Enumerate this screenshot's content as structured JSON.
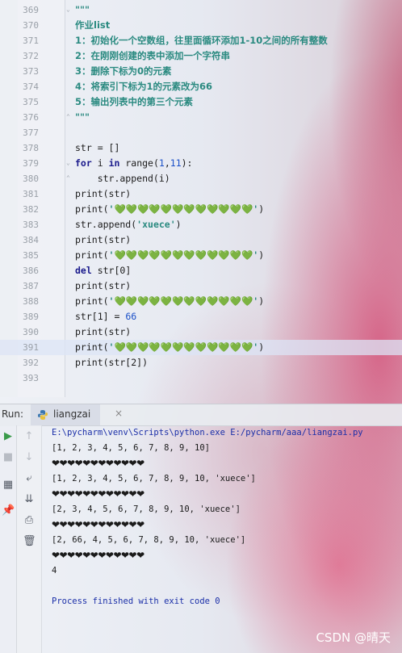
{
  "editor": {
    "lines": [
      {
        "n": "369",
        "text": "\"\"\""
      },
      {
        "n": "370",
        "text": "作业list"
      },
      {
        "n": "371",
        "text": "1：初始化一个空数组，往里面循环添加1-10之间的所有整数"
      },
      {
        "n": "372",
        "text": "2：在刚刚创建的表中添加一个字符串"
      },
      {
        "n": "373",
        "text": "3：删除下标为0的元素"
      },
      {
        "n": "374",
        "text": "4：将索引下标为1的元素改为66"
      },
      {
        "n": "375",
        "text": "5：输出列表中的第三个元素"
      },
      {
        "n": "376",
        "text": "\"\"\""
      },
      {
        "n": "377",
        "text": ""
      },
      {
        "n": "378",
        "text": "str = []"
      },
      {
        "n": "379",
        "text": "for i in range(1,11):"
      },
      {
        "n": "380",
        "text": "    str.append(i)"
      },
      {
        "n": "381",
        "text": "print(str)"
      },
      {
        "n": "382",
        "text": "print('💚💚💚💚💚💚💚💚💚💚💚💚')"
      },
      {
        "n": "383",
        "text": "str.append('xuece')"
      },
      {
        "n": "384",
        "text": "print(str)"
      },
      {
        "n": "385",
        "text": "print('💚💚💚💚💚💚💚💚💚💚💚💚')"
      },
      {
        "n": "386",
        "text": "del str[0]"
      },
      {
        "n": "387",
        "text": "print(str)"
      },
      {
        "n": "388",
        "text": "print('💚💚💚💚💚💚💚💚💚💚💚💚')"
      },
      {
        "n": "389",
        "text": "str[1] = 66"
      },
      {
        "n": "390",
        "text": "print(str)"
      },
      {
        "n": "391",
        "text": "print('💚💚💚💚💚💚💚💚💚💚💚💚')"
      },
      {
        "n": "392",
        "text": "print(str[2])"
      },
      {
        "n": "393",
        "text": ""
      }
    ],
    "current_line": "391"
  },
  "run_panel": {
    "label": "Run:",
    "tab_label": "liangzai",
    "close_glyph": "×",
    "console": {
      "command": "E:\\pycharm\\venv\\Scripts\\python.exe E:/pycharm/aaa/liangzai.py",
      "out1": "[1, 2, 3, 4, 5, 6, 7, 8, 9, 10]",
      "hearts1": "❤❤❤❤❤❤❤❤❤❤❤❤",
      "out2": "[1, 2, 3, 4, 5, 6, 7, 8, 9, 10, 'xuece']",
      "hearts2": "❤❤❤❤❤❤❤❤❤❤❤❤",
      "out3": "[2, 3, 4, 5, 6, 7, 8, 9, 10, 'xuece']",
      "hearts3": "❤❤❤❤❤❤❤❤❤❤❤❤",
      "out4": "[2, 66, 4, 5, 6, 7, 8, 9, 10, 'xuece']",
      "hearts4": "❤❤❤❤❤❤❤❤❤❤❤❤",
      "out5": "4",
      "exit": "Process finished with exit code 0"
    }
  },
  "watermark": "CSDN @晴天",
  "colors": {
    "docstring": "#2a8a80",
    "keyword": "#1a1a8c",
    "console_blue": "#1b2fa8",
    "run_green": "#3a9a4a"
  }
}
